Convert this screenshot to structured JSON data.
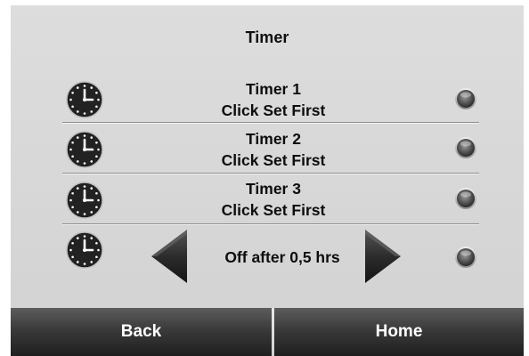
{
  "header": {
    "title": "Timer"
  },
  "timers": [
    {
      "name": "Timer 1",
      "status": "Click Set First",
      "icon": "clock-icon",
      "indicator": "off"
    },
    {
      "name": "Timer 2",
      "status": "Click Set First",
      "icon": "clock-icon",
      "indicator": "off"
    },
    {
      "name": "Timer 3",
      "status": "Click Set First",
      "icon": "clock-icon",
      "indicator": "off"
    }
  ],
  "off_timer": {
    "label": "Off after 0,5 hrs",
    "icon": "clock-icon",
    "indicator": "off",
    "decrease_icon": "arrow-left-icon",
    "increase_icon": "arrow-right-icon"
  },
  "footer": {
    "back_label": "Back",
    "home_label": "Home"
  },
  "colors": {
    "background": "#d6d6d6",
    "button": "#2e2e2e",
    "button_text": "#ffffff",
    "text": "#111111"
  }
}
